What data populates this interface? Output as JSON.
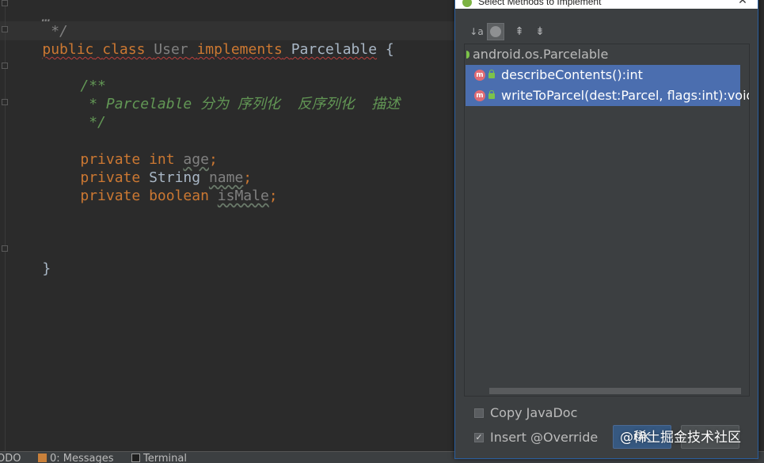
{
  "editor": {
    "lines": {
      "line0": "…",
      "line1": " */",
      "class_kw_public": "public",
      "class_kw_class": "class",
      "class_name": "User",
      "class_kw_implements": "implements",
      "class_interface": "Parcelable",
      "class_brace": "{",
      "doc_open": "/**",
      "doc_body": " * Parcelable 分为 序列化  反序列化  描述",
      "doc_close": " */",
      "field_private": "private",
      "field1_type": "int",
      "field1_name": "age",
      "field2_type": "String",
      "field2_name": "name",
      "field3_type": "boolean",
      "field3_name": "isMale",
      "semicolon": ";",
      "close_brace": "}"
    }
  },
  "statusbar": {
    "todo": "ODO",
    "messages": "0: Messages",
    "terminal": "Terminal"
  },
  "dialog": {
    "title": "Select Methods to Implement",
    "close": "✕",
    "toolbar": {
      "sort_icon": "↓a",
      "expand_icon": "⇞",
      "collapse_icon": "⇟"
    },
    "tree": {
      "root": "android.os.Parcelable",
      "methods": [
        "describeContents():int",
        "writeToParcel(dest:Parcel, flags:int):void"
      ],
      "method_icon_letter": "m"
    },
    "options": {
      "copy_javadoc": "Copy JavaDoc",
      "insert_override": "Insert @Override",
      "copy_javadoc_checked": false,
      "insert_override_checked": true,
      "check_mark": "✓"
    },
    "buttons": {
      "ok": "OK",
      "cancel": ""
    }
  },
  "watermark": "@稀土掘金技术社区",
  "colors": {
    "editor_bg": "#2b2b2b",
    "keyword": "#cc7832",
    "doc_comment": "#629755",
    "selection": "#4b6eaf",
    "dialog_bg": "#3c3f41"
  }
}
